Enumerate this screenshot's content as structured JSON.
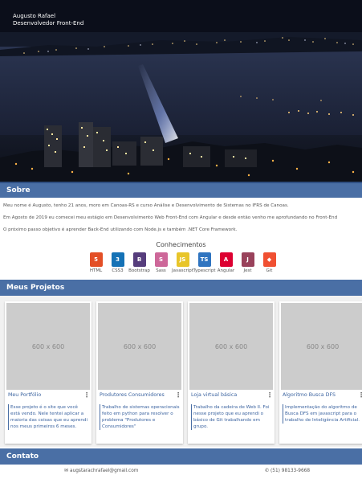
{
  "hero": {
    "name": "Augusto Rafael",
    "role": "Desenvolvedor Front-End"
  },
  "about": {
    "title": "Sobre",
    "paragraphs": [
      "Meu nome é Augusto, tenho 21 anos, moro em Canoas-RS e curso Análise e Desenvolvimento de Sistemas no IFRS de Canoas.",
      "Em Agosto de 2019 eu comecei meu estágio em Desenvolvimento Web Front-End com Angular e desde então venho me aprofundando no Front-End",
      "O próximo passo objetivo é aprender Back-End utilizando com Node.js e também .NET Core Framework."
    ],
    "skills_title": "Conhecimentos",
    "skills": [
      {
        "label": "HTML",
        "icon": "html5-icon",
        "glyph": "5",
        "color": "#e34f26"
      },
      {
        "label": "CSS3",
        "icon": "css3-icon",
        "glyph": "3",
        "color": "#1572b6"
      },
      {
        "label": "Bootstrap",
        "icon": "bootstrap-icon",
        "glyph": "B",
        "color": "#563d7c"
      },
      {
        "label": "Sass",
        "icon": "sass-icon",
        "glyph": "S",
        "color": "#cd6799"
      },
      {
        "label": "Javascript",
        "icon": "javascript-icon",
        "glyph": "JS",
        "color": "#e8c52a"
      },
      {
        "label": "Typescript",
        "icon": "typescript-icon",
        "glyph": "TS",
        "color": "#2f74c0"
      },
      {
        "label": "Angular",
        "icon": "angular-icon",
        "glyph": "A",
        "color": "#dd0031"
      },
      {
        "label": "Jest",
        "icon": "jest-icon",
        "glyph": "J",
        "color": "#99425b"
      },
      {
        "label": "Git",
        "icon": "git-icon",
        "glyph": "◆",
        "color": "#f05032"
      }
    ]
  },
  "projects": {
    "title": "Meus Projetos",
    "placeholder": "600 x 600",
    "items": [
      {
        "title": "Meu Portfólio",
        "description": "Esse projeto é o site que você está vendo. Nele tentei aplicar a maioria das coisas que eu aprendi nos meus primeiros 6 meses."
      },
      {
        "title": "Produtores Consumidores",
        "description": "Trabalho de sistemas operacionais feito em python para resolver o problema \"Produtores e Consumidores\""
      },
      {
        "title": "Loja virtual básica",
        "description": "Trabalho da cadeira de Web II. Foi nesse projeto que eu aprendi o básico de Git trabalhando em grupo."
      },
      {
        "title": "Algoritmo Busca DFS",
        "description": "Implementação do algoritmo de Busca DFS em javascript para o trabalho de Inteligência Artificial."
      }
    ]
  },
  "contact": {
    "title": "Contato",
    "email": "augstarachrafael@gmail.com",
    "phone": "(51) 98133-9668"
  }
}
